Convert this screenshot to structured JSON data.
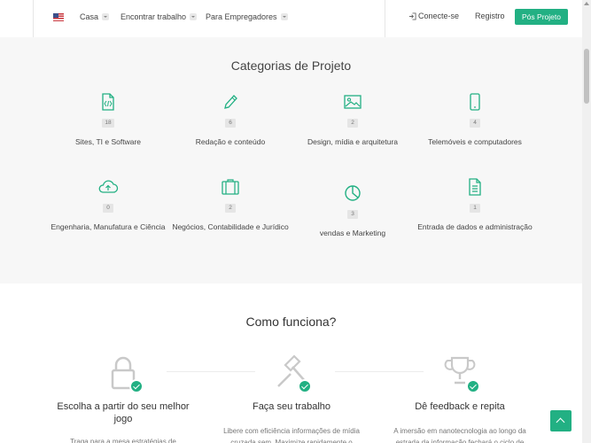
{
  "header": {
    "nav": [
      {
        "label": "Casa"
      },
      {
        "label": "Encontrar trabalho"
      },
      {
        "label": "Para Empregadores"
      }
    ],
    "login_label": "Conecte-se",
    "register_label": "Registro",
    "post_button_label": "Pós Projeto"
  },
  "categories": {
    "title": "Categorias de Projeto",
    "items": [
      {
        "icon": "code-file-icon",
        "count": "18",
        "label": "Sites, TI e Software"
      },
      {
        "icon": "pencil-icon",
        "count": "6",
        "label": "Redação e conteúdo"
      },
      {
        "icon": "image-icon",
        "count": "2",
        "label": "Design, mídia e arquitetura"
      },
      {
        "icon": "mobile-phone-icon",
        "count": "4",
        "label": "Telemóveis e computadores"
      },
      {
        "icon": "cloud-upload-icon",
        "count": "0",
        "label": "Engenharia, Manufatura e Ciência"
      },
      {
        "icon": "briefcase-icon",
        "count": "2",
        "label": "Negócios, Contabilidade e Jurídico"
      },
      {
        "icon": "pie-chart-icon",
        "count": "3",
        "label": "vendas e Marketing"
      },
      {
        "icon": "document-icon",
        "count": "1",
        "label": "Entrada de dados e administração"
      }
    ]
  },
  "how": {
    "title": "Como funciona?",
    "steps": [
      {
        "icon": "lock-icon",
        "title": "Escolha a partir do seu melhor jogo",
        "text": "Traga para a mesa estratégias de"
      },
      {
        "icon": "gavel-icon",
        "title": "Faça seu trabalho",
        "text": "Libere com eficiência informações de mídia cruzada sem. Maximize rapidamente o"
      },
      {
        "icon": "trophy-icon",
        "title": "Dê feedback e repita",
        "text": "A imersão em nanotecnologia ao longo da estrada da informação fechará o ciclo de"
      }
    ]
  },
  "colors": {
    "accent": "#22b083"
  }
}
